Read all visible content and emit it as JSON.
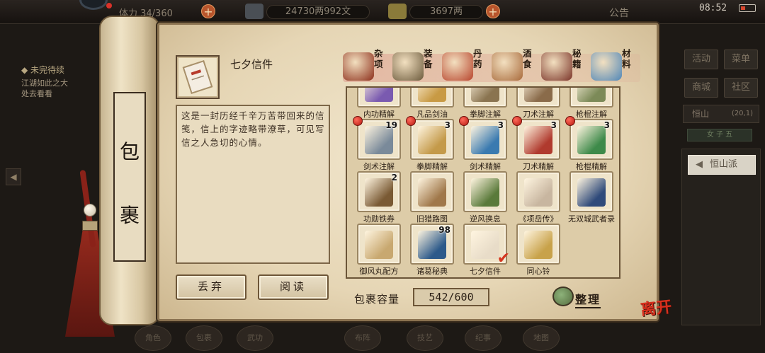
{
  "topbar": {
    "stamina": "体力 34/360",
    "silver": "24730两992文",
    "gold": "3697两",
    "notice": "公告",
    "clock": "08:52"
  },
  "quest": {
    "title": "◆ 未完待续",
    "lines": [
      "江湖如此之大",
      "处去看看"
    ]
  },
  "right_menu": {
    "buttons": [
      "活动",
      "菜单",
      "商城",
      "社区"
    ],
    "location": "恒山",
    "coords": "(20,1)",
    "tab": "女 子 五",
    "sect": "恒山派"
  },
  "bottom_nav": [
    "角色",
    "包裹",
    "武功",
    "布阵",
    "技艺",
    "纪事",
    "地图"
  ],
  "scroll_title": "包 裹",
  "selected_item": {
    "name": "七夕信件",
    "description": "这是一封历经千辛万苦带回来的信笺，信上的字迹略带潦草，可见写信之人急切的心情。"
  },
  "buttons": {
    "discard": "丢弃",
    "read": "阅读",
    "sort": "整理",
    "leave": "离开"
  },
  "categories": [
    {
      "label": "杂项",
      "icon": "jar-icon",
      "color": "#8c2e1a"
    },
    {
      "label": "装备",
      "icon": "weapon-bundle-icon",
      "color": "#6b5a3c"
    },
    {
      "label": "丹药",
      "icon": "pills-icon",
      "color": "#b7442c"
    },
    {
      "label": "酒食",
      "icon": "food-icon",
      "color": "#a86a3b"
    },
    {
      "label": "秘籍",
      "icon": "books-icon",
      "color": "#7a3328"
    },
    {
      "label": "材料",
      "icon": "crystal-icon",
      "color": "#4f86b7"
    }
  ],
  "inventory": [
    {
      "label": "内功精解",
      "count": "",
      "badge": false,
      "checked": false,
      "color": "#7a5ab0"
    },
    {
      "label": "凡品剑油",
      "count": "",
      "badge": false,
      "checked": false,
      "color": "#c89a44"
    },
    {
      "label": "拳脚注解",
      "count": "",
      "badge": false,
      "checked": false,
      "color": "#8a7450"
    },
    {
      "label": "刀术注解",
      "count": "",
      "badge": false,
      "checked": false,
      "color": "#8a6b4a"
    },
    {
      "label": "枪棍注解",
      "count": "",
      "badge": false,
      "checked": false,
      "color": "#7c8a58"
    },
    {
      "label": "剑术注解",
      "count": "19",
      "badge": true,
      "checked": false,
      "color": "#7a8a9a"
    },
    {
      "label": "拳脚精解",
      "count": "3",
      "badge": true,
      "checked": false,
      "color": "#c49a4a"
    },
    {
      "label": "剑术精解",
      "count": "3",
      "badge": true,
      "checked": false,
      "color": "#3a7ab0"
    },
    {
      "label": "刀术精解",
      "count": "3",
      "badge": true,
      "checked": false,
      "color": "#b03a2e"
    },
    {
      "label": "枪棍精解",
      "count": "3",
      "badge": true,
      "checked": false,
      "color": "#3e8a4a"
    },
    {
      "label": "功勋铁券",
      "count": "2",
      "badge": false,
      "checked": false,
      "color": "#7a5a34"
    },
    {
      "label": "旧猎路图",
      "count": "",
      "badge": false,
      "checked": false,
      "color": "#a0784a"
    },
    {
      "label": "逆风换息",
      "count": "",
      "badge": false,
      "checked": false,
      "color": "#5a7a3a"
    },
    {
      "label": "《项岳传》",
      "count": "",
      "badge": false,
      "checked": false,
      "color": "#c8b6a0"
    },
    {
      "label": "无双城武者录",
      "count": "",
      "badge": false,
      "checked": false,
      "color": "#2f4a7a"
    },
    {
      "label": "御风丸配方",
      "count": "",
      "badge": false,
      "checked": false,
      "color": "#c8a870"
    },
    {
      "label": "诸葛秘典",
      "count": "98",
      "badge": false,
      "checked": false,
      "color": "#2d5a8a"
    },
    {
      "label": "七夕信件",
      "count": "",
      "badge": false,
      "checked": true,
      "color": "#e8dcc8"
    },
    {
      "label": "同心铃",
      "count": "",
      "badge": false,
      "checked": false,
      "color": "#c8a24a"
    }
  ],
  "capacity": {
    "label": "包裹容量",
    "value": "542/600"
  }
}
